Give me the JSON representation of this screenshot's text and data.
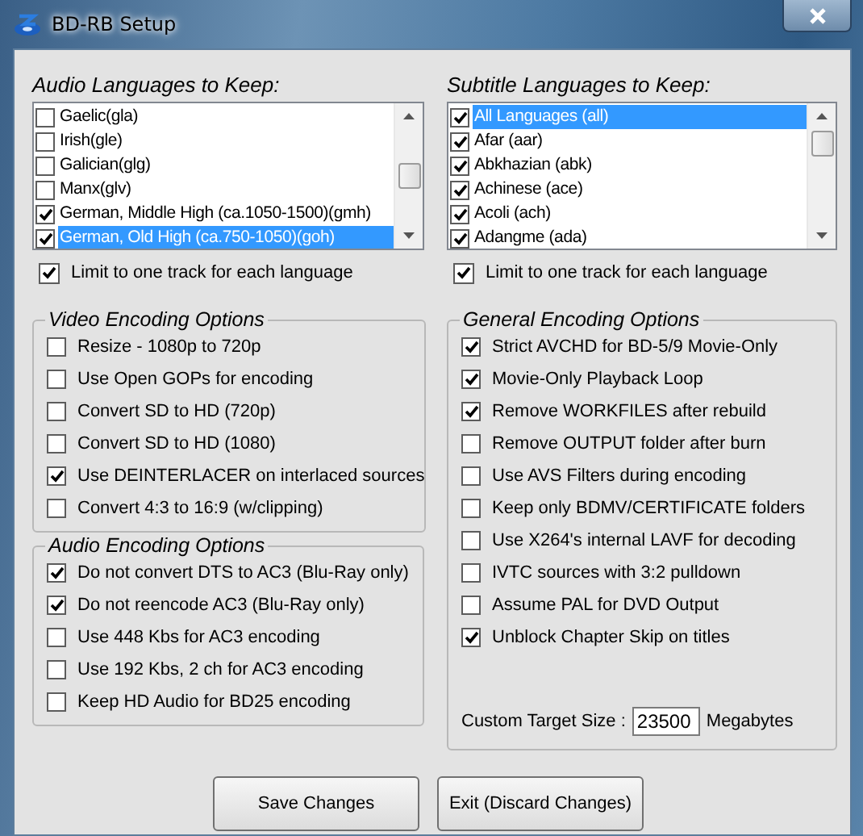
{
  "window": {
    "title": "BD-RB Setup"
  },
  "audio_languages": {
    "title": "Audio Languages to Keep:",
    "items": [
      {
        "label": "Gaelic(gla)",
        "checked": false,
        "selected": false
      },
      {
        "label": "Irish(gle)",
        "checked": false,
        "selected": false
      },
      {
        "label": "Galician(glg)",
        "checked": false,
        "selected": false
      },
      {
        "label": "Manx(glv)",
        "checked": false,
        "selected": false
      },
      {
        "label": "German, Middle High (ca.1050-1500)(gmh)",
        "checked": true,
        "selected": false
      },
      {
        "label": "German, Old High (ca.750-1050)(goh)",
        "checked": true,
        "selected": true
      }
    ],
    "limit": {
      "label": "Limit to one track for each language",
      "checked": true
    }
  },
  "subtitle_languages": {
    "title": "Subtitle Languages to Keep:",
    "items": [
      {
        "label": "All Languages (all)",
        "checked": true,
        "selected": true
      },
      {
        "label": "Afar (aar)",
        "checked": true,
        "selected": false
      },
      {
        "label": "Abkhazian (abk)",
        "checked": true,
        "selected": false
      },
      {
        "label": "Achinese (ace)",
        "checked": true,
        "selected": false
      },
      {
        "label": "Acoli (ach)",
        "checked": true,
        "selected": false
      },
      {
        "label": "Adangme (ada)",
        "checked": true,
        "selected": false
      }
    ],
    "limit": {
      "label": "Limit to one track for each language",
      "checked": true
    }
  },
  "video_encoding_options": {
    "title": "Video Encoding Options",
    "options": [
      {
        "label": "Resize  - 1080p to 720p",
        "checked": false
      },
      {
        "label": "Use Open GOPs for encoding",
        "checked": false
      },
      {
        "label": "Convert SD to HD (720p)",
        "checked": false
      },
      {
        "label": "Convert SD to HD (1080)",
        "checked": false
      },
      {
        "label": "Use DEINTERLACER on interlaced sources",
        "checked": true
      },
      {
        "label": "Convert 4:3 to 16:9 (w/clipping)",
        "checked": false
      }
    ]
  },
  "audio_encoding_options": {
    "title": "Audio Encoding Options",
    "options": [
      {
        "label": "Do not convert DTS to AC3  (Blu-Ray only)",
        "checked": true
      },
      {
        "label": "Do not reencode AC3  (Blu-Ray only)",
        "checked": true
      },
      {
        "label": "Use 448 Kbs for AC3 encoding",
        "checked": false
      },
      {
        "label": "Use 192 Kbs, 2 ch for AC3 encoding",
        "checked": false
      },
      {
        "label": "Keep HD Audio for BD25 encoding",
        "checked": false
      }
    ]
  },
  "general_encoding_options": {
    "title": "General Encoding Options",
    "options": [
      {
        "label": "Strict AVCHD for BD-5/9 Movie-Only",
        "checked": true
      },
      {
        "label": "Movie-Only Playback Loop",
        "checked": true
      },
      {
        "label": "Remove WORKFILES after rebuild",
        "checked": true
      },
      {
        "label": "Remove OUTPUT folder after burn",
        "checked": false
      },
      {
        "label": "Use AVS Filters during encoding",
        "checked": false
      },
      {
        "label": "Keep only BDMV/CERTIFICATE folders",
        "checked": false
      },
      {
        "label": "Use X264's internal LAVF for decoding",
        "checked": false
      },
      {
        "label": "IVTC sources with 3:2 pulldown",
        "checked": false
      },
      {
        "label": "Assume PAL for DVD Output",
        "checked": false
      },
      {
        "label": "Unblock Chapter Skip on titles",
        "checked": true
      }
    ],
    "custom_target_size": {
      "label": "Custom Target Size :",
      "value": "23500",
      "unit": "Megabytes"
    }
  },
  "buttons": [
    "Save Changes",
    "Exit (Discard Changes)"
  ]
}
